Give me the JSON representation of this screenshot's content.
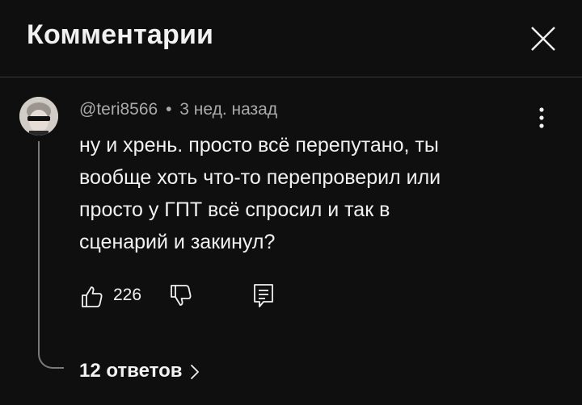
{
  "header": {
    "title": "Комментарии"
  },
  "comment": {
    "author": "@teri8566",
    "separator": "•",
    "time": "3 нед. назад",
    "text": "ну и хрень. просто всё перепутано, ты\nвообще хоть что-то перепроверил или\nпросто у ГПТ всё спросил и так в\nсценарий и закинул?",
    "likes": "226",
    "replies_label": "12 ответов"
  },
  "icons": {
    "close": "close-icon",
    "more": "more-vertical-icon",
    "like": "thumbs-up-icon",
    "dislike": "thumbs-down-icon",
    "reply": "reply-icon",
    "chevron": "chevron-right-icon"
  },
  "colors": {
    "background": "#0f0f0f",
    "text": "#f1f1f1",
    "secondary": "#aaaaaa",
    "divider": "#3a3a3a"
  }
}
